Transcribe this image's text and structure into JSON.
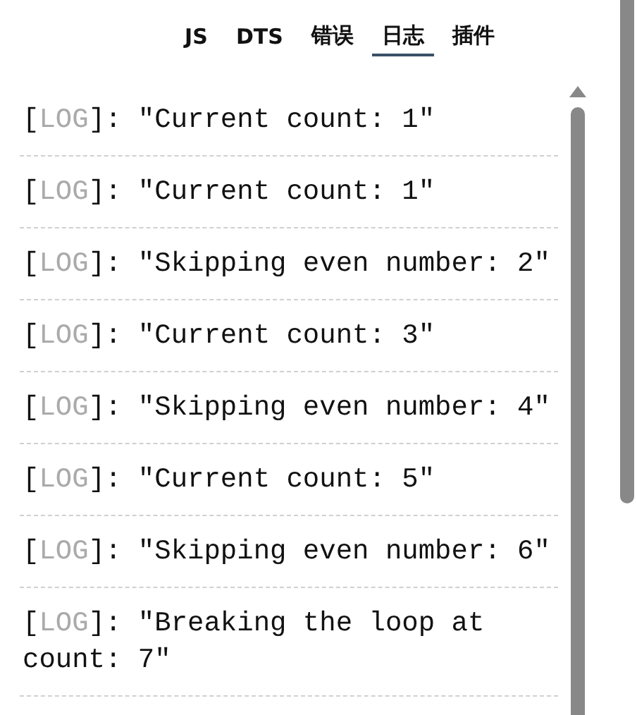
{
  "tabs": [
    {
      "label": "JS",
      "selected": false
    },
    {
      "label": "DTS",
      "selected": false
    },
    {
      "label": "错误",
      "selected": false
    },
    {
      "label": "日志",
      "selected": true
    },
    {
      "label": "插件",
      "selected": false
    }
  ],
  "logs": [
    {
      "open": "[",
      "level": "LOG",
      "rest": "]: \"Current count: 1\""
    },
    {
      "open": "[",
      "level": "LOG",
      "rest": "]: \"Current count: 1\""
    },
    {
      "open": "[",
      "level": "LOG",
      "rest": "]: \"Skipping even number: 2\""
    },
    {
      "open": "[",
      "level": "LOG",
      "rest": "]: \"Current count: 3\""
    },
    {
      "open": "[",
      "level": "LOG",
      "rest": "]: \"Skipping even number: 4\""
    },
    {
      "open": "[",
      "level": "LOG",
      "rest": "]: \"Current count: 5\""
    },
    {
      "open": "[",
      "level": "LOG",
      "rest": "]: \"Skipping even number: 6\""
    },
    {
      "open": "[",
      "level": "LOG",
      "rest": "]: \"Breaking the loop at count: 7\""
    }
  ]
}
